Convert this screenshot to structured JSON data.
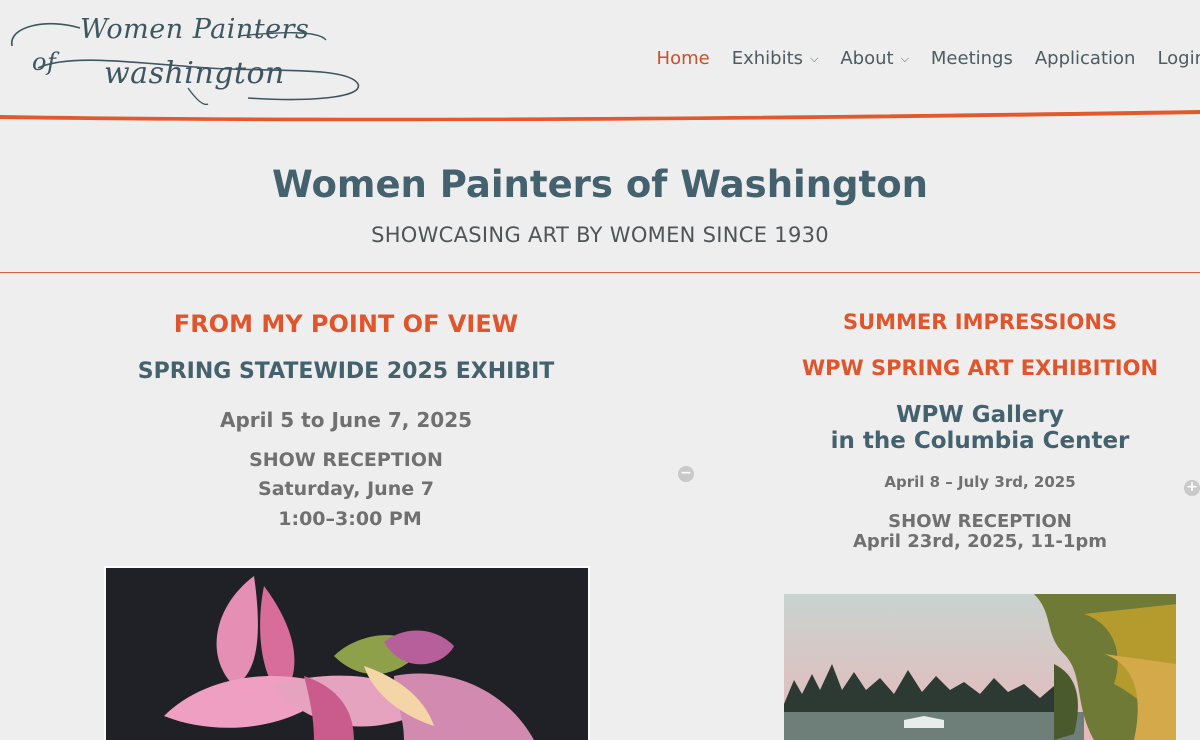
{
  "header": {
    "logo": {
      "line1": "Women Painters",
      "of": "of",
      "line2": "washington"
    },
    "nav": [
      {
        "label": "Home",
        "active": true,
        "dropdown": false
      },
      {
        "label": "Exhibits",
        "active": false,
        "dropdown": true
      },
      {
        "label": "About",
        "active": false,
        "dropdown": true
      },
      {
        "label": "Meetings",
        "active": false,
        "dropdown": false
      },
      {
        "label": "Application",
        "active": false,
        "dropdown": false
      },
      {
        "label": "Login",
        "active": false,
        "dropdown": false
      }
    ]
  },
  "hero": {
    "title": "Women Painters of Washington",
    "subtitle": "SHOWCASING ART BY WOMEN SINCE 1930"
  },
  "left": {
    "theme": "FROM MY POINT OF VIEW",
    "exhibit": "SPRING STATEWIDE 2025 EXHIBIT",
    "dates": "April 5 to June 7, 2025",
    "reception_label": "SHOW RECEPTION",
    "reception_day": "Saturday, June 7",
    "reception_time": "1:00–3:00 PM"
  },
  "right": {
    "theme": "SUMMER IMPRESSIONS",
    "exhibit": "WPW SPRING ART EXHIBITION",
    "venue_line1": "WPW Gallery",
    "venue_line2": "in the Columbia Center",
    "dates": "April 8 – July 3rd, 2025",
    "reception_label": "SHOW RECEPTION",
    "reception_time": "April 23rd, 2025, 11-1pm"
  },
  "icons": {
    "collapse": "minus-circle-icon",
    "expand": "plus-circle-icon"
  },
  "colors": {
    "accent_orange": "#e0552b",
    "slate": "#44616e",
    "background": "#efeeee"
  }
}
